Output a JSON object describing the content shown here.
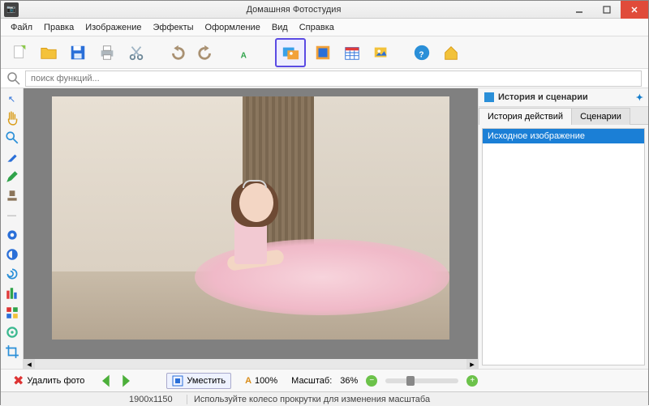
{
  "titlebar": {
    "app_title": "Домашняя Фотостудия",
    "app_icon": "camera-icon"
  },
  "menubar": {
    "items": [
      "Файл",
      "Правка",
      "Изображение",
      "Эффекты",
      "Оформление",
      "Вид",
      "Справка"
    ]
  },
  "toolbar": {
    "icons": [
      {
        "name": "new-file-icon",
        "color1": "#fff",
        "color2": "#8cc94a"
      },
      {
        "name": "open-folder-icon",
        "color1": "#f4c23a",
        "color2": "#d99c18"
      },
      {
        "name": "save-disk-icon",
        "color1": "#2a6fd8",
        "color2": "#1c52a8"
      },
      {
        "name": "print-icon",
        "color1": "#aeb7bd",
        "color2": "#7a848b"
      },
      {
        "name": "cut-icon",
        "color1": "#9fb4c4",
        "color2": "#6b8596"
      },
      {
        "name": "undo-icon",
        "color1": "#a99172",
        "color2": "#8b755a"
      },
      {
        "name": "redo-icon",
        "color1": "#a99172",
        "color2": "#8b755a"
      },
      {
        "name": "text-icon",
        "color1": "#2fa34a",
        "color2": "#1f7a33"
      },
      {
        "name": "image-icon-highlight",
        "color1": "#3aa0e8",
        "color2": "#f2a23a"
      },
      {
        "name": "frame-icon",
        "color1": "#f2a23a",
        "color2": "#2a6fd8"
      },
      {
        "name": "calendar-icon",
        "color1": "#2a6fd8",
        "color2": "#e03a3a"
      },
      {
        "name": "effects-icon",
        "color1": "#f2c23a",
        "color2": "#2a6fd8"
      },
      {
        "name": "help-icon",
        "color1": "#2a8fd8",
        "color2": "#fff"
      },
      {
        "name": "home-icon",
        "color1": "#f2c23a",
        "color2": "#d99c18"
      }
    ]
  },
  "search": {
    "placeholder": "поиск функций..."
  },
  "tools": [
    {
      "name": "pointer-tool-icon",
      "sym": "↖",
      "color": "#2a6fd8"
    },
    {
      "name": "hand-tool-icon",
      "sym": "✋",
      "color": "#d99c18"
    },
    {
      "name": "zoom-tool-icon",
      "sym": "🔍",
      "color": "#2a8fd8"
    },
    {
      "name": "brush-tool-icon",
      "sym": "🖌",
      "color": "#2a6fd8"
    },
    {
      "name": "pencil-tool-icon",
      "sym": "✎",
      "color": "#2fa34a"
    },
    {
      "name": "stamp-tool-icon",
      "sym": "⊡",
      "color": "#8b755a"
    },
    {
      "name": "eraser-tool-icon",
      "sym": "⌫",
      "color": "#999"
    },
    {
      "name": "redeye-tool-icon",
      "sym": "◉",
      "color": "#2a6fd8"
    },
    {
      "name": "darkcircle-tool-icon",
      "sym": "◐",
      "color": "#2a6fd8"
    },
    {
      "name": "swirl-tool-icon",
      "sym": "๑",
      "color": "#2a8fd8"
    },
    {
      "name": "levels-tool-icon",
      "sym": "▮",
      "color": "#e03a3a"
    },
    {
      "name": "palette-tool-icon",
      "sym": "▦",
      "color": "#d33"
    },
    {
      "name": "patch-tool-icon",
      "sym": "◎",
      "color": "#3ab88f"
    },
    {
      "name": "crop-tool-icon",
      "sym": "⟡",
      "color": "#2a8fd8"
    }
  ],
  "sidepanel": {
    "title": "История и сценарии",
    "tabs": [
      "История действий",
      "Сценарии"
    ],
    "active_tab": 0,
    "history_items": [
      "Исходное изображение"
    ]
  },
  "bottombar": {
    "delete_label": "Удалить фото",
    "fit_label": "Уместить",
    "zoom_percent_label": "100%",
    "scale_label": "Масштаб:",
    "scale_value": "36%"
  },
  "statusbar": {
    "coords": "",
    "dims": "1900x1150",
    "hint": "Используйте колесо прокрутки для изменения масштаба"
  }
}
